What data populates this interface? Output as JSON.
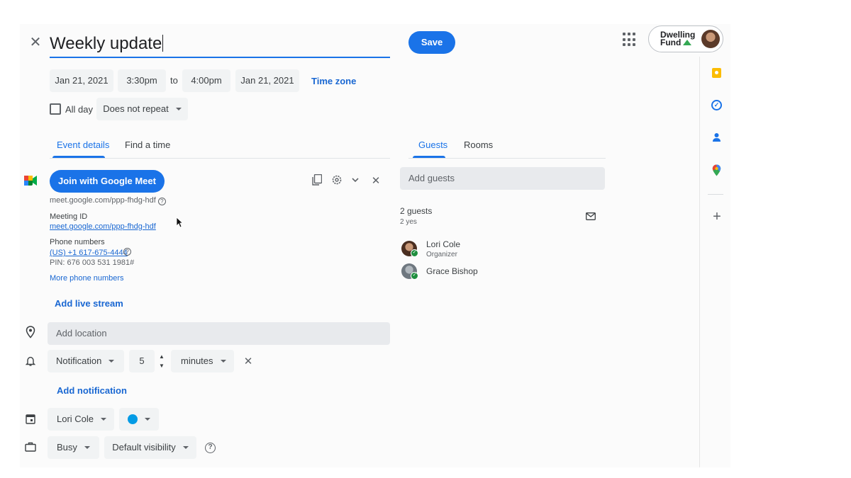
{
  "header": {
    "title": "Weekly update",
    "save_label": "Save",
    "brand_line1": "Dwelling",
    "brand_line2": "Fund"
  },
  "datetime": {
    "start_date": "Jan 21, 2021",
    "start_time": "3:30pm",
    "to_label": "to",
    "end_time": "4:00pm",
    "end_date": "Jan 21, 2021",
    "time_zone_label": "Time zone",
    "all_day_label": "All day",
    "repeat_value": "Does not repeat"
  },
  "tabs": {
    "event_details": "Event details",
    "find_a_time": "Find a time"
  },
  "meet": {
    "join_label": "Join with Google Meet",
    "url": "meet.google.com/ppp-fhdg-hdf",
    "meeting_id_label": "Meeting ID",
    "meeting_id_link": "meet.google.com/ppp-fhdg-hdf",
    "phone_label": "Phone numbers",
    "phone_number": "(US) +1 617-675-4444",
    "pin": "PIN: 676 003 531 1981#",
    "more_phone_numbers": "More phone numbers",
    "add_live_stream": "Add live stream"
  },
  "location": {
    "placeholder": "Add location"
  },
  "notification": {
    "type": "Notification",
    "amount": "5",
    "unit": "minutes",
    "add_label": "Add notification"
  },
  "calendar": {
    "owner": "Lori Cole",
    "color": "#039be5"
  },
  "availability": {
    "status": "Busy",
    "visibility": "Default visibility"
  },
  "guests_panel": {
    "tab_guests": "Guests",
    "tab_rooms": "Rooms",
    "add_placeholder": "Add guests",
    "count_label": "2 guests",
    "yes_label": "2 yes",
    "guests": [
      {
        "name": "Lori Cole",
        "role": "Organizer"
      },
      {
        "name": "Grace Bishop",
        "role": ""
      }
    ]
  },
  "colors": {
    "accent": "#1a73e8",
    "keep": "#fbbc04",
    "tasks": "#1a73e8",
    "contacts": "#1a73e8"
  },
  "icons": [
    "close-icon",
    "apps-grid-icon",
    "google-meet-icon",
    "copy-icon",
    "settings-icon",
    "chevron-down-icon",
    "location-pin-icon",
    "bell-icon",
    "calendar-icon",
    "briefcase-icon",
    "help-icon",
    "mail-icon",
    "keep-icon",
    "tasks-icon",
    "contacts-icon",
    "maps-icon",
    "add-icon"
  ]
}
